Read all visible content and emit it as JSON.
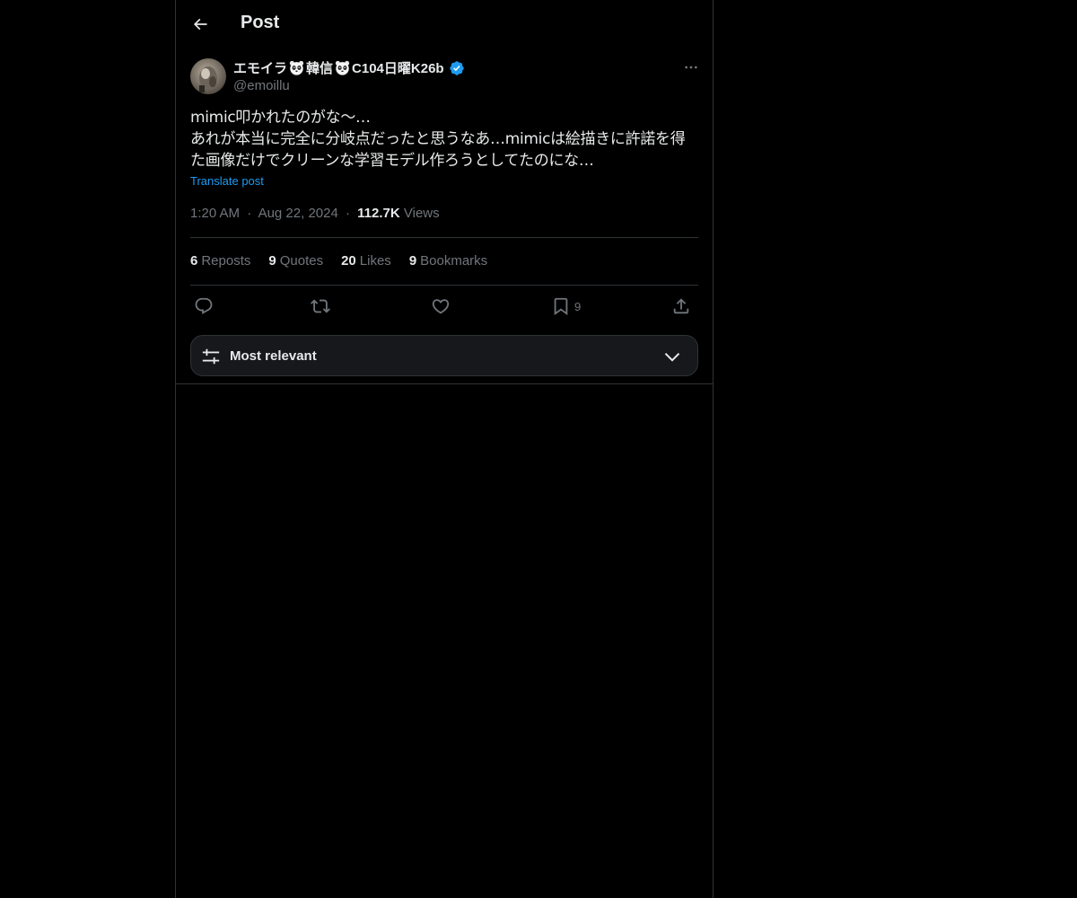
{
  "header": {
    "title": "Post",
    "back_icon": "arrow-left-icon"
  },
  "author": {
    "name_part1": "エモイラ",
    "name_part2": "韓信",
    "name_part3": "C104日曜K26b",
    "handle": "@emoillu",
    "verified": true,
    "verified_color": "#1d9bf0"
  },
  "post": {
    "line1": "mimic叩かれたのがな〜…",
    "line2": "あれが本当に完全に分岐点だったと思うなあ…mimicは絵描きに許諾を得",
    "line3": "た画像だけでクリーンな学習モデル作ろうとしてたのにな…",
    "translate_label": "Translate post",
    "time": "1:20 AM",
    "separator": "·",
    "date": "Aug 22, 2024",
    "views_count": "112.7K",
    "views_label": "Views"
  },
  "stats": {
    "reposts_count": "6",
    "reposts_label": "Reposts",
    "quotes_count": "9",
    "quotes_label": "Quotes",
    "likes_count": "20",
    "likes_label": "Likes",
    "bookmarks_count": "9",
    "bookmarks_label": "Bookmarks"
  },
  "actions": {
    "reply_icon": "reply-icon",
    "repost_icon": "repost-icon",
    "like_icon": "heart-icon",
    "bookmark_icon": "bookmark-icon",
    "bookmark_count": "9",
    "share_icon": "share-icon"
  },
  "sort": {
    "label": "Most relevant",
    "icon": "sliders-icon",
    "chevron": "chevron-down-icon"
  },
  "colors": {
    "background": "#000000",
    "text": "#e7e9ea",
    "secondary": "#71767b",
    "accent": "#1d9bf0",
    "border": "#2f3336"
  }
}
